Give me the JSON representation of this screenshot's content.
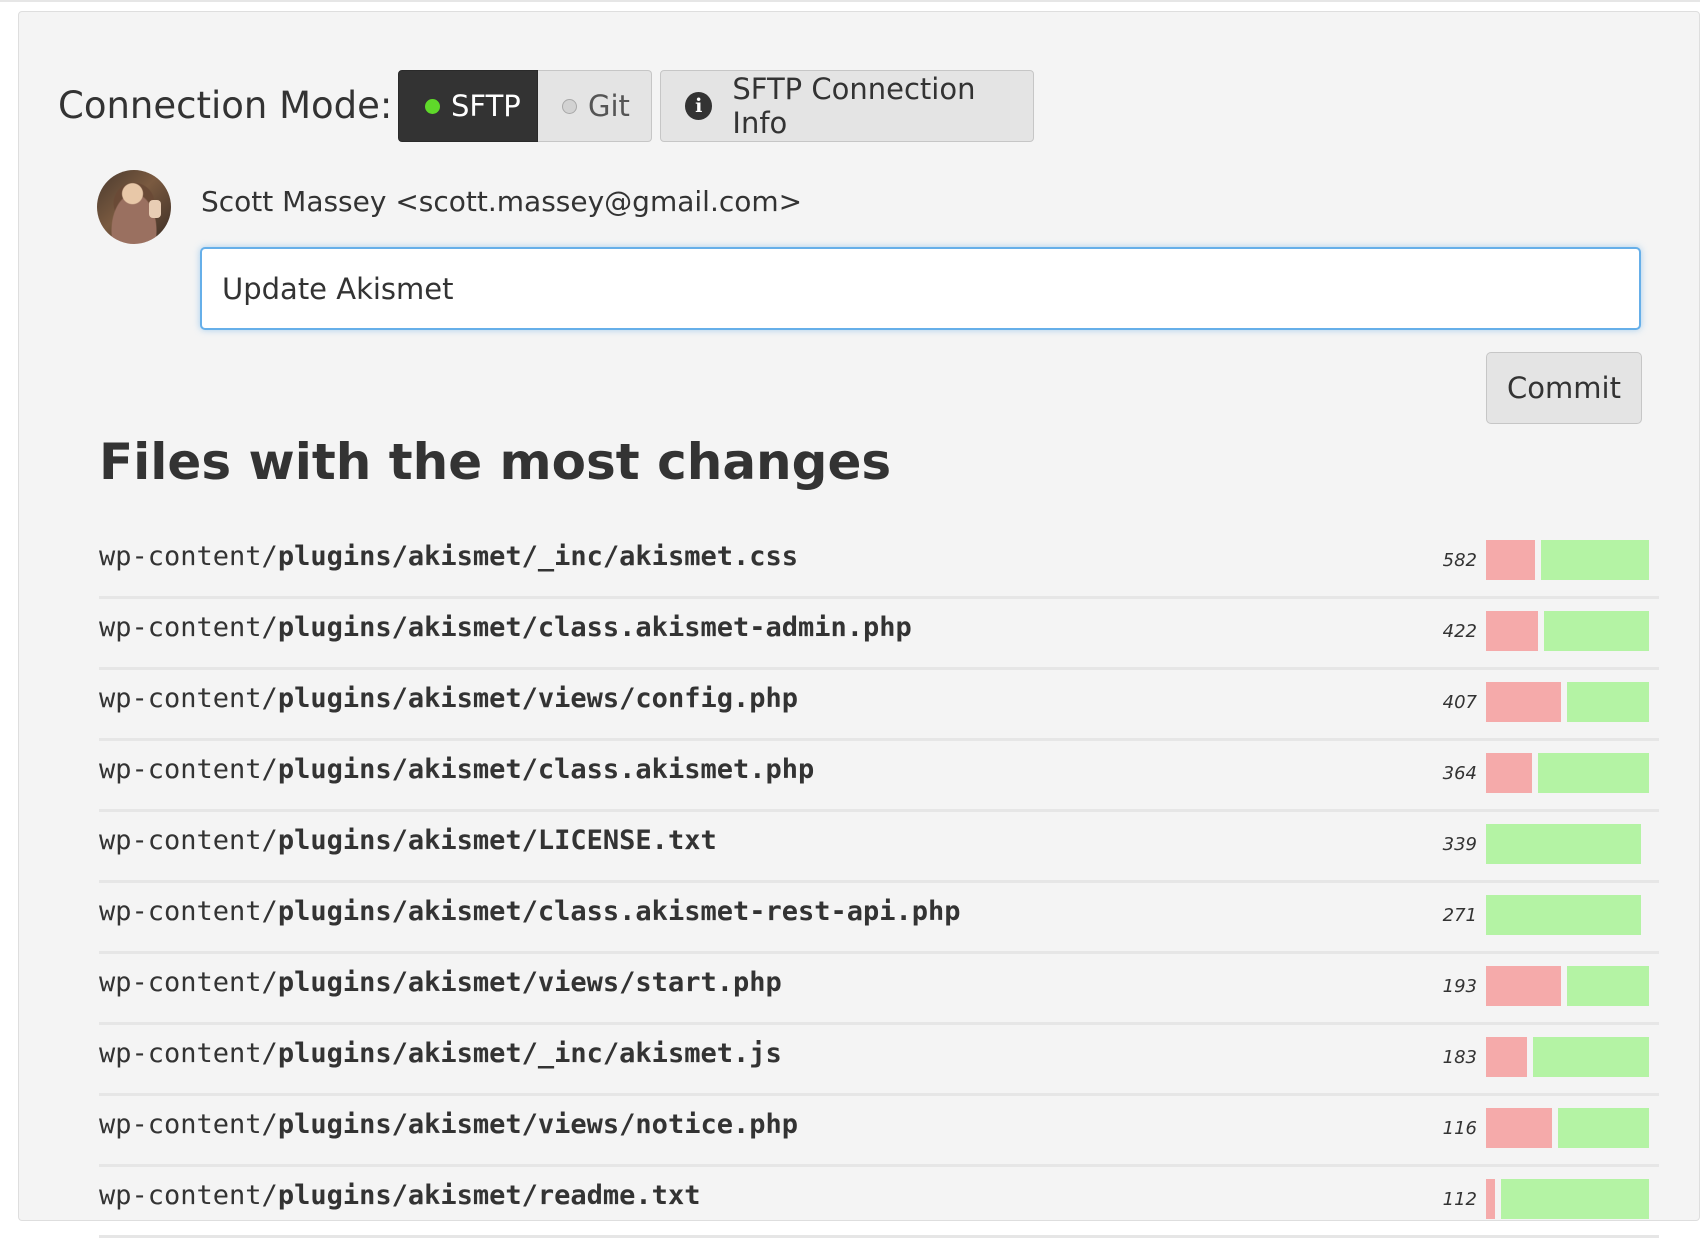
{
  "connection": {
    "label": "Connection Mode:",
    "modes": [
      {
        "label": "SFTP",
        "active": true,
        "status_color": "#5fd92a"
      },
      {
        "label": "Git",
        "active": false,
        "status_color": "#d2d2d2"
      }
    ],
    "info_button_label": "SFTP Connection Info"
  },
  "commit": {
    "author": "Scott Massey <scott.massey@gmail.com>",
    "message": "Update Akismet",
    "button_label": "Commit"
  },
  "changes": {
    "title": "Files with the most changes",
    "files": [
      {
        "prefix": "wp-content/",
        "path": "plugins/akismet/_inc/akismet.css",
        "count": "582",
        "deleted_fraction": 0.31
      },
      {
        "prefix": "wp-content/",
        "path": "plugins/akismet/class.akismet-admin.php",
        "count": "422",
        "deleted_fraction": 0.33
      },
      {
        "prefix": "wp-content/",
        "path": "plugins/akismet/views/config.php",
        "count": "407",
        "deleted_fraction": 0.48
      },
      {
        "prefix": "wp-content/",
        "path": "plugins/akismet/class.akismet.php",
        "count": "364",
        "deleted_fraction": 0.29
      },
      {
        "prefix": "wp-content/",
        "path": "plugins/akismet/LICENSE.txt",
        "count": "339",
        "deleted_fraction": 0
      },
      {
        "prefix": "wp-content/",
        "path": "plugins/akismet/class.akismet-rest-api.php",
        "count": "271",
        "deleted_fraction": 0
      },
      {
        "prefix": "wp-content/",
        "path": "plugins/akismet/views/start.php",
        "count": "193",
        "deleted_fraction": 0.48
      },
      {
        "prefix": "wp-content/",
        "path": "plugins/akismet/_inc/akismet.js",
        "count": "183",
        "deleted_fraction": 0.26
      },
      {
        "prefix": "wp-content/",
        "path": "plugins/akismet/views/notice.php",
        "count": "116",
        "deleted_fraction": 0.42
      },
      {
        "prefix": "wp-content/",
        "path": "plugins/akismet/readme.txt",
        "count": "112",
        "deleted_fraction": 0.06
      }
    ]
  },
  "colors": {
    "deleted": "#f5aaaa",
    "added": "#b4f3a4",
    "focus": "#66afe9"
  }
}
